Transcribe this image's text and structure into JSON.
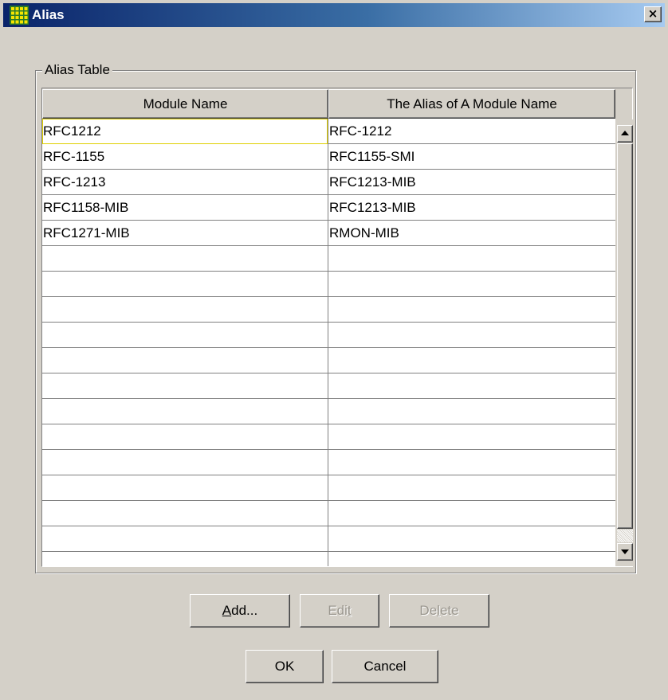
{
  "window": {
    "title": "Alias",
    "close_label": "×"
  },
  "group": {
    "label": "Alias Table"
  },
  "table": {
    "columns": [
      "Module Name",
      "The Alias of A Module Name"
    ],
    "rows": [
      [
        "RFC1212",
        "RFC-1212"
      ],
      [
        "RFC-1155",
        "RFC1155-SMI"
      ],
      [
        "RFC-1213",
        "RFC1213-MIB"
      ],
      [
        "RFC1158-MIB",
        "RFC1213-MIB"
      ],
      [
        "RFC1271-MIB",
        "RMON-MIB"
      ],
      [
        "",
        ""
      ],
      [
        "",
        ""
      ],
      [
        "",
        ""
      ],
      [
        "",
        ""
      ],
      [
        "",
        ""
      ],
      [
        "",
        ""
      ],
      [
        "",
        ""
      ],
      [
        "",
        ""
      ],
      [
        "",
        ""
      ],
      [
        "",
        ""
      ],
      [
        "",
        ""
      ],
      [
        "",
        ""
      ],
      [
        "",
        ""
      ]
    ],
    "focused_cell": "row 1, column 1"
  },
  "buttons": {
    "add": {
      "pre": "",
      "mnemonic": "A",
      "post": "dd...",
      "enabled": true
    },
    "edit": {
      "pre": "Edi",
      "mnemonic": "t",
      "post": "",
      "enabled": false
    },
    "delete": {
      "pre": "De",
      "mnemonic": "l",
      "post": "ete",
      "enabled": false
    },
    "ok": {
      "label": "OK"
    },
    "cancel": {
      "label": "Cancel"
    }
  },
  "colors": {
    "titlebar_start": "#0a246a",
    "titlebar_end": "#a6caf0",
    "face": "#d4d0c8",
    "focus_border": "#e0d000"
  }
}
